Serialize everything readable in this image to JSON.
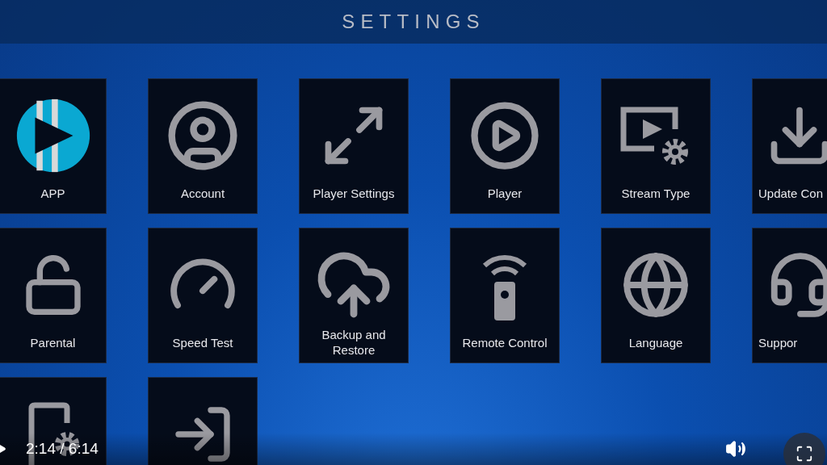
{
  "header": {
    "title": "SETTINGS"
  },
  "tile_rows": [
    [
      {
        "label": "APP"
      },
      {
        "label": "Account"
      },
      {
        "label": "Player Settings"
      },
      {
        "label": "Player"
      },
      {
        "label": "Stream Type"
      },
      {
        "label": "Update Con"
      }
    ],
    [
      {
        "label": "Parental"
      },
      {
        "label": "Speed Test"
      },
      {
        "label": "Backup and Restore"
      },
      {
        "label": "Remote Control"
      },
      {
        "label": "Language"
      },
      {
        "label": "Suppor"
      }
    ],
    [
      {},
      {}
    ]
  ],
  "video_controls": {
    "time": "2:14 / 6:14"
  }
}
